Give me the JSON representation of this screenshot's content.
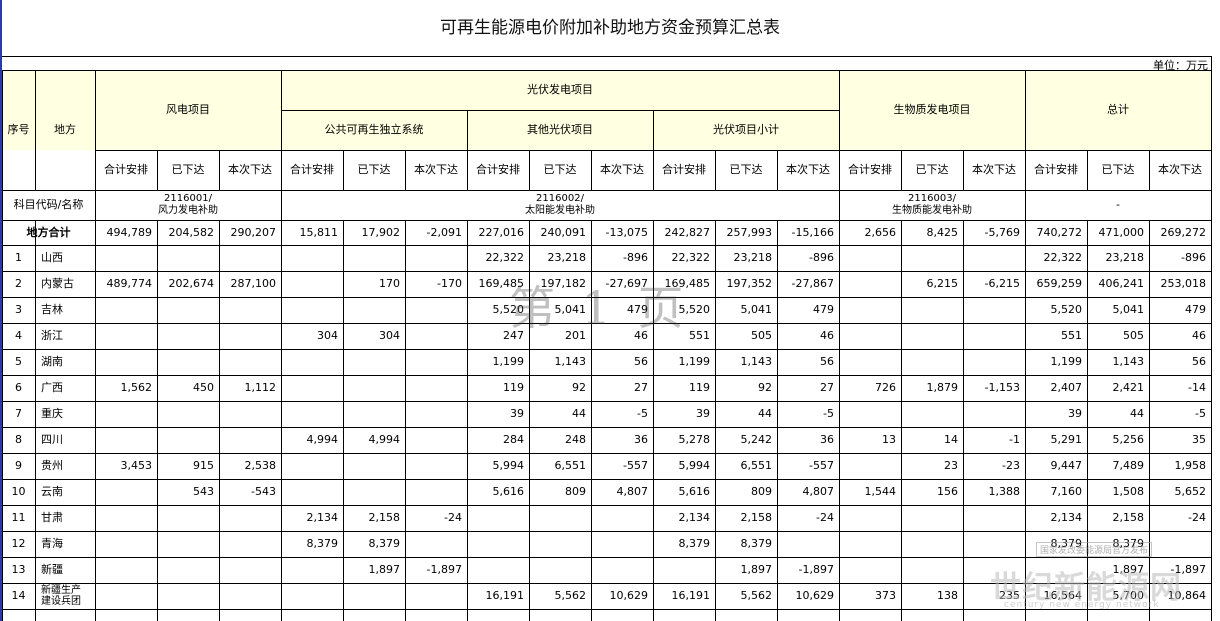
{
  "title": "可再生能源电价附加补助地方资金预算汇总表",
  "unit": "单位：万元",
  "headers": {
    "seq": "序号",
    "region": "地方",
    "wind": "风电项目",
    "pv": "光伏发电项目",
    "pv_public": "公共可再生独立系统",
    "pv_other": "其他光伏项目",
    "pv_subtotal": "光伏项目小计",
    "bio": "生物质发电项目",
    "total": "总计",
    "sub": [
      "合计安排",
      "已下达",
      "本次下达"
    ]
  },
  "code_row": {
    "label": "科目代码/名称",
    "wind": "2116001/\n风力发电补助",
    "pv": "2116002/\n太阳能发电补助",
    "bio": "2116003/\n生物质能发电补助",
    "total": "-"
  },
  "total_row": {
    "label": "地方合计",
    "values": [
      "494,789",
      "204,582",
      "290,207",
      "15,811",
      "17,902",
      "-2,091",
      "227,016",
      "240,091",
      "-13,075",
      "242,827",
      "257,993",
      "-15,166",
      "2,656",
      "8,425",
      "-5,769",
      "740,272",
      "471,000",
      "269,272"
    ]
  },
  "rows": [
    {
      "seq": "1",
      "name": "山西",
      "values": [
        "",
        "",
        "",
        "",
        "",
        "",
        "22,322",
        "23,218",
        "-896",
        "22,322",
        "23,218",
        "-896",
        "",
        "",
        "",
        "22,322",
        "23,218",
        "-896"
      ]
    },
    {
      "seq": "2",
      "name": "内蒙古",
      "values": [
        "489,774",
        "202,674",
        "287,100",
        "",
        "170",
        "-170",
        "169,485",
        "197,182",
        "-27,697",
        "169,485",
        "197,352",
        "-27,867",
        "",
        "6,215",
        "-6,215",
        "659,259",
        "406,241",
        "253,018"
      ]
    },
    {
      "seq": "3",
      "name": "吉林",
      "values": [
        "",
        "",
        "",
        "",
        "",
        "",
        "5,520",
        "5,041",
        "479",
        "5,520",
        "5,041",
        "479",
        "",
        "",
        "",
        "5,520",
        "5,041",
        "479"
      ]
    },
    {
      "seq": "4",
      "name": "浙江",
      "values": [
        "",
        "",
        "",
        "304",
        "304",
        "",
        "247",
        "201",
        "46",
        "551",
        "505",
        "46",
        "",
        "",
        "",
        "551",
        "505",
        "46"
      ]
    },
    {
      "seq": "5",
      "name": "湖南",
      "values": [
        "",
        "",
        "",
        "",
        "",
        "",
        "1,199",
        "1,143",
        "56",
        "1,199",
        "1,143",
        "56",
        "",
        "",
        "",
        "1,199",
        "1,143",
        "56"
      ]
    },
    {
      "seq": "6",
      "name": "广西",
      "values": [
        "1,562",
        "450",
        "1,112",
        "",
        "",
        "",
        "119",
        "92",
        "27",
        "119",
        "92",
        "27",
        "726",
        "1,879",
        "-1,153",
        "2,407",
        "2,421",
        "-14"
      ]
    },
    {
      "seq": "7",
      "name": "重庆",
      "values": [
        "",
        "",
        "",
        "",
        "",
        "",
        "39",
        "44",
        "-5",
        "39",
        "44",
        "-5",
        "",
        "",
        "",
        "39",
        "44",
        "-5"
      ]
    },
    {
      "seq": "8",
      "name": "四川",
      "values": [
        "",
        "",
        "",
        "4,994",
        "4,994",
        "",
        "284",
        "248",
        "36",
        "5,278",
        "5,242",
        "36",
        "13",
        "14",
        "-1",
        "5,291",
        "5,256",
        "35"
      ]
    },
    {
      "seq": "9",
      "name": "贵州",
      "values": [
        "3,453",
        "915",
        "2,538",
        "",
        "",
        "",
        "5,994",
        "6,551",
        "-557",
        "5,994",
        "6,551",
        "-557",
        "",
        "23",
        "-23",
        "9,447",
        "7,489",
        "1,958"
      ]
    },
    {
      "seq": "10",
      "name": "云南",
      "values": [
        "",
        "543",
        "-543",
        "",
        "",
        "",
        "5,616",
        "809",
        "4,807",
        "5,616",
        "809",
        "4,807",
        "1,544",
        "156",
        "1,388",
        "7,160",
        "1,508",
        "5,652"
      ]
    },
    {
      "seq": "11",
      "name": "甘肃",
      "values": [
        "",
        "",
        "",
        "2,134",
        "2,158",
        "-24",
        "",
        "",
        "",
        "2,134",
        "2,158",
        "-24",
        "",
        "",
        "",
        "2,134",
        "2,158",
        "-24"
      ]
    },
    {
      "seq": "12",
      "name": "青海",
      "values": [
        "",
        "",
        "",
        "8,379",
        "8,379",
        "",
        "",
        "",
        "",
        "8,379",
        "8,379",
        "",
        "",
        "",
        "",
        "8,379",
        "8,379",
        ""
      ]
    },
    {
      "seq": "13",
      "name": "新疆",
      "values": [
        "",
        "",
        "",
        "",
        "1,897",
        "-1,897",
        "",
        "",
        "",
        "",
        "1,897",
        "-1,897",
        "",
        "",
        "",
        "",
        "1,897",
        "-1,897"
      ]
    },
    {
      "seq": "14",
      "name": "新疆生产\n建设兵团",
      "values": [
        "",
        "",
        "",
        "",
        "",
        "",
        "16,191",
        "5,562",
        "10,629",
        "16,191",
        "5,562",
        "10,629",
        "373",
        "138",
        "235",
        "16,564",
        "5,700",
        "10,864"
      ]
    }
  ],
  "stamp": "第 1 页",
  "watermark": {
    "small": "国家发改委能源局官方发布",
    "big": "世纪新能源网",
    "sub": "century new energy network"
  }
}
